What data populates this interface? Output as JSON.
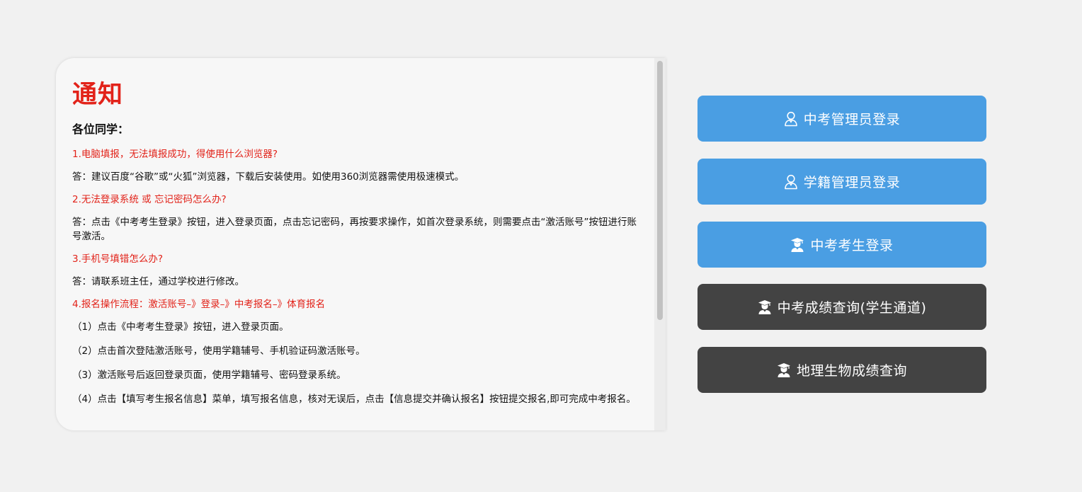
{
  "notice": {
    "title": "通知",
    "greeting": "各位同学：",
    "items": [
      {
        "q": "1.电脑填报，无法填报成功，得使用什么浏览器?",
        "a": "答：建议百度“谷歌”或“火狐”浏览器，下载后安装使用。如使用360浏览器需使用极速模式。"
      },
      {
        "q": "2.无法登录系统 或 忘记密码怎么办?",
        "a": "答：点击《中考考生登录》按钮，进入登录页面，点击忘记密码，再按要求操作，如首次登录系统，则需要点击“激活账号”按钮进行账号激活。"
      },
      {
        "q": "3.手机号填错怎么办?",
        "a": "答：请联系班主任，通过学校进行修改。"
      }
    ],
    "process_title": "4.报名操作流程：激活账号–》登录–》中考报名–》体育报名",
    "steps": [
      "（1）点击《中考考生登录》按钮，进入登录页面。",
      "（2）点击首次登陆激活账号，使用学籍辅号、手机验证码激活账号。",
      "（3）激活账号后返回登录页面，使用学籍辅号、密码登录系统。",
      "（4）点击【填写考生报名信息】菜单，填写报名信息，核对无误后，点击【信息提交并确认报名】按钮提交报名,即可完成中考报名。"
    ]
  },
  "buttons": [
    {
      "label": "中考管理员登录",
      "icon": "admin-user-icon",
      "color": "#4a9ee3"
    },
    {
      "label": "学籍管理员登录",
      "icon": "admin-user-icon",
      "color": "#4a9ee3"
    },
    {
      "label": "中考考生登录",
      "icon": "student-graduate-icon",
      "color": "#4a9ee3"
    },
    {
      "label": "中考成绩查询(学生通道)",
      "icon": "student-graduate-icon",
      "color": "#434343"
    },
    {
      "label": "地理生物成绩查询",
      "icon": "student-graduate-icon",
      "color": "#434343"
    }
  ],
  "colors": {
    "accent_red": "#e2231a",
    "button_blue": "#4a9ee3",
    "button_dark": "#434343",
    "background": "#f1f1f1"
  }
}
